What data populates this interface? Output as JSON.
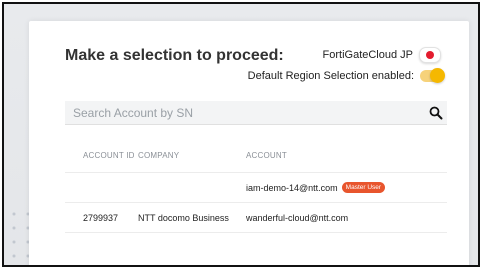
{
  "page": {
    "title": "Make a selection to proceed:"
  },
  "cloud_selector": {
    "label": "FortiGateCloud JP",
    "indicator_color": "#e31c2e"
  },
  "region": {
    "label": "Default Region Selection enabled:",
    "enabled": true,
    "toggle_color": "#f5b800"
  },
  "search": {
    "placeholder": "Search Account by SN",
    "icon": "search-icon"
  },
  "table": {
    "headers": [
      "ACCOUNT ID",
      "COMPANY",
      "ACCOUNT"
    ],
    "rows": [
      {
        "account_id": "",
        "company": "",
        "account": "iam-demo-14@ntt.com",
        "badge": "Master User"
      },
      {
        "account_id": "2799937",
        "company": "NTT docomo Business",
        "account": "wanderful-cloud@ntt.com",
        "badge": ""
      }
    ],
    "badge_color": "#e8552d"
  }
}
